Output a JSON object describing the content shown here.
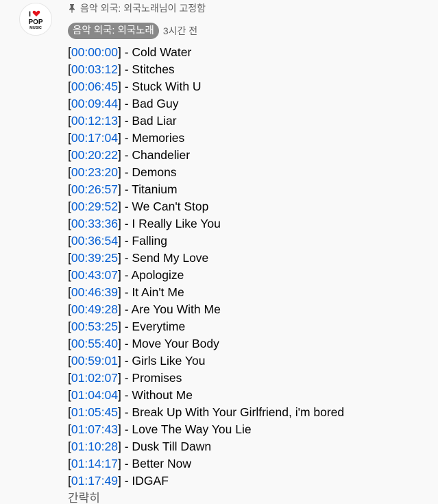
{
  "avatar": {
    "heart_color": "#e4121b",
    "text_color": "#111111",
    "logo_text": [
      "I",
      "POP",
      "MUSIC"
    ]
  },
  "pinned": {
    "text": "음악 외국: 외국노래님이 고정함"
  },
  "author": {
    "name": "음악 외국: 외국노래",
    "time": "3시간 전"
  },
  "tracks": [
    {
      "ts": "00:00:00",
      "title": "Cold Water"
    },
    {
      "ts": "00:03:12",
      "title": "Stitches"
    },
    {
      "ts": "00:06:45",
      "title": "Stuck With U"
    },
    {
      "ts": "00:09:44",
      "title": "Bad Guy"
    },
    {
      "ts": "00:12:13",
      "title": "Bad Liar"
    },
    {
      "ts": "00:17:04",
      "title": "Memories"
    },
    {
      "ts": "00:20:22",
      "title": "Chandelier"
    },
    {
      "ts": "00:23:20",
      "title": "Demons"
    },
    {
      "ts": "00:26:57",
      "title": "Titanium"
    },
    {
      "ts": "00:29:52",
      "title": "We Can't Stop"
    },
    {
      "ts": "00:33:36",
      "title": "I Really Like You"
    },
    {
      "ts": "00:36:54",
      "title": "Falling"
    },
    {
      "ts": "00:39:25",
      "title": "Send My Love"
    },
    {
      "ts": "00:43:07",
      "title": "Apologize"
    },
    {
      "ts": "00:46:39",
      "title": "It Ain't Me"
    },
    {
      "ts": "00:49:28",
      "title": "Are You With Me"
    },
    {
      "ts": "00:53:25",
      "title": "Everytime"
    },
    {
      "ts": "00:55:40",
      "title": "Move Your Body"
    },
    {
      "ts": "00:59:01",
      "title": "Girls Like You"
    },
    {
      "ts": "01:02:07",
      "title": "Promises"
    },
    {
      "ts": "01:04:04",
      "title": "Without Me"
    },
    {
      "ts": "01:05:45",
      "title": "Break Up With Your Girlfriend, i'm bored"
    },
    {
      "ts": "01:07:43",
      "title": "Love The Way You Lie"
    },
    {
      "ts": "01:10:28",
      "title": "Dusk Till Dawn"
    },
    {
      "ts": "01:14:17",
      "title": "Better Now"
    },
    {
      "ts": "01:17:49",
      "title": "IDGAF"
    }
  ],
  "collapse_label": "간략히",
  "colors": {
    "timestamp_link": "#065fd4",
    "badge_bg": "#888888",
    "muted_text": "#606060"
  }
}
